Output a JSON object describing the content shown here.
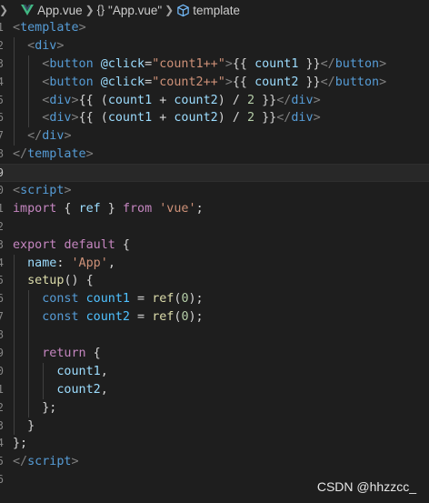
{
  "breadcrumb": {
    "file": "App.vue",
    "component": "\"App.vue\"",
    "section": "template",
    "colors": {
      "vue_green": "#41b883",
      "vue_dark": "#35495e",
      "cube_blue": "#75beff"
    },
    "icons": [
      "vue-logo-icon",
      "chevron-right-icon",
      "braces-icon",
      "cube-icon"
    ]
  },
  "code": {
    "lines": [
      [
        [
          "t-br",
          "<"
        ],
        [
          "t-tag",
          "template"
        ],
        [
          "t-br",
          ">"
        ]
      ],
      [
        [
          "t-br",
          "  <"
        ],
        [
          "t-tag",
          "div"
        ],
        [
          "t-br",
          ">"
        ]
      ],
      [
        [
          "t-br",
          "    <"
        ],
        [
          "t-tag",
          "button"
        ],
        [
          "t-plain",
          " "
        ],
        [
          "t-attr",
          "@click"
        ],
        [
          "t-plain",
          "="
        ],
        [
          "t-str",
          "\"count1++\""
        ],
        [
          "t-br",
          ">"
        ],
        [
          "t-plain",
          "{{ "
        ],
        [
          "t-var",
          "count1"
        ],
        [
          "t-plain",
          " }}"
        ],
        [
          "t-br",
          "</"
        ],
        [
          "t-tag",
          "button"
        ],
        [
          "t-br",
          ">"
        ]
      ],
      [
        [
          "t-br",
          "    <"
        ],
        [
          "t-tag",
          "button"
        ],
        [
          "t-plain",
          " "
        ],
        [
          "t-attr",
          "@click"
        ],
        [
          "t-plain",
          "="
        ],
        [
          "t-str",
          "\"count2++\""
        ],
        [
          "t-br",
          ">"
        ],
        [
          "t-plain",
          "{{ "
        ],
        [
          "t-var",
          "count2"
        ],
        [
          "t-plain",
          " }}"
        ],
        [
          "t-br",
          "</"
        ],
        [
          "t-tag",
          "button"
        ],
        [
          "t-br",
          ">"
        ]
      ],
      [
        [
          "t-br",
          "    <"
        ],
        [
          "t-tag",
          "div"
        ],
        [
          "t-br",
          ">"
        ],
        [
          "t-plain",
          "{{ ("
        ],
        [
          "t-var",
          "count1"
        ],
        [
          "t-plain",
          " + "
        ],
        [
          "t-var",
          "count2"
        ],
        [
          "t-plain",
          ") / "
        ],
        [
          "t-num",
          "2"
        ],
        [
          "t-plain",
          " }}"
        ],
        [
          "t-br",
          "</"
        ],
        [
          "t-tag",
          "div"
        ],
        [
          "t-br",
          ">"
        ]
      ],
      [
        [
          "t-br",
          "    <"
        ],
        [
          "t-tag",
          "div"
        ],
        [
          "t-br",
          ">"
        ],
        [
          "t-plain",
          "{{ ("
        ],
        [
          "t-var",
          "count1"
        ],
        [
          "t-plain",
          " + "
        ],
        [
          "t-var",
          "count2"
        ],
        [
          "t-plain",
          ") / "
        ],
        [
          "t-num",
          "2"
        ],
        [
          "t-plain",
          " }}"
        ],
        [
          "t-br",
          "</"
        ],
        [
          "t-tag",
          "div"
        ],
        [
          "t-br",
          ">"
        ]
      ],
      [
        [
          "t-br",
          "  </"
        ],
        [
          "t-tag",
          "div"
        ],
        [
          "t-br",
          ">"
        ]
      ],
      [
        [
          "t-br",
          "</"
        ],
        [
          "t-tag",
          "template"
        ],
        [
          "t-br",
          ">"
        ]
      ],
      [],
      [
        [
          "t-br",
          "<"
        ],
        [
          "t-tag",
          "script"
        ],
        [
          "t-br",
          ">"
        ]
      ],
      [
        [
          "t-ctrl",
          "import"
        ],
        [
          "t-plain",
          " { "
        ],
        [
          "t-var",
          "ref"
        ],
        [
          "t-plain",
          " } "
        ],
        [
          "t-ctrl",
          "from"
        ],
        [
          "t-plain",
          " "
        ],
        [
          "t-str",
          "'vue'"
        ],
        [
          "t-plain",
          ";"
        ]
      ],
      [],
      [
        [
          "t-ctrl",
          "export"
        ],
        [
          "t-plain",
          " "
        ],
        [
          "t-ctrl",
          "default"
        ],
        [
          "t-plain",
          " {"
        ]
      ],
      [
        [
          "t-plain",
          "  "
        ],
        [
          "t-prop",
          "name"
        ],
        [
          "t-plain",
          ": "
        ],
        [
          "t-str",
          "'App'"
        ],
        [
          "t-plain",
          ","
        ]
      ],
      [
        [
          "t-plain",
          "  "
        ],
        [
          "t-fn",
          "setup"
        ],
        [
          "t-plain",
          "() {"
        ]
      ],
      [
        [
          "t-plain",
          "    "
        ],
        [
          "t-kw",
          "const"
        ],
        [
          "t-plain",
          " "
        ],
        [
          "t-const",
          "count1"
        ],
        [
          "t-plain",
          " = "
        ],
        [
          "t-fn",
          "ref"
        ],
        [
          "t-plain",
          "("
        ],
        [
          "t-num",
          "0"
        ],
        [
          "t-plain",
          ");"
        ]
      ],
      [
        [
          "t-plain",
          "    "
        ],
        [
          "t-kw",
          "const"
        ],
        [
          "t-plain",
          " "
        ],
        [
          "t-const",
          "count2"
        ],
        [
          "t-plain",
          " = "
        ],
        [
          "t-fn",
          "ref"
        ],
        [
          "t-plain",
          "("
        ],
        [
          "t-num",
          "0"
        ],
        [
          "t-plain",
          ");"
        ]
      ],
      [],
      [
        [
          "t-plain",
          "    "
        ],
        [
          "t-ctrl",
          "return"
        ],
        [
          "t-plain",
          " {"
        ]
      ],
      [
        [
          "t-plain",
          "      "
        ],
        [
          "t-var",
          "count1"
        ],
        [
          "t-plain",
          ","
        ]
      ],
      [
        [
          "t-plain",
          "      "
        ],
        [
          "t-var",
          "count2"
        ],
        [
          "t-plain",
          ","
        ]
      ],
      [
        [
          "t-plain",
          "    };"
        ]
      ],
      [
        [
          "t-plain",
          "  }"
        ]
      ],
      [
        [
          "t-plain",
          "};"
        ]
      ],
      [
        [
          "t-br",
          "</"
        ],
        [
          "t-tag",
          "script"
        ],
        [
          "t-br",
          ">"
        ]
      ],
      []
    ],
    "line_numbers": [
      "1",
      "2",
      "3",
      "4",
      "5",
      "6",
      "7",
      "8",
      "9",
      "0",
      "1",
      "2",
      "3",
      "4",
      "5",
      "6",
      "7",
      "8",
      "9",
      "0",
      "1",
      "2",
      "3",
      "4",
      "5",
      "6"
    ],
    "active_line": 8,
    "indent_levels": [
      0,
      1,
      2,
      2,
      2,
      2,
      1,
      0,
      0,
      0,
      0,
      0,
      0,
      1,
      1,
      2,
      2,
      2,
      2,
      3,
      3,
      2,
      1,
      0,
      0,
      0
    ]
  },
  "watermark": "CSDN @hhzzcc_"
}
